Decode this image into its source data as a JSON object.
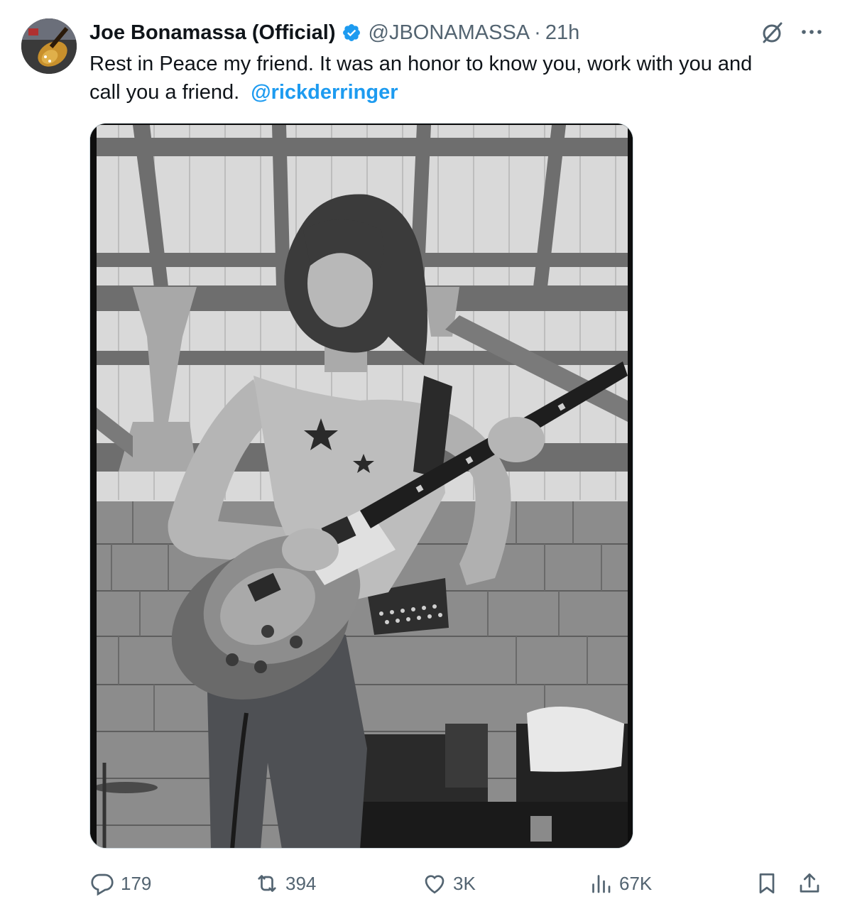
{
  "tweet": {
    "author": {
      "display_name": "Joe Bonamassa (Official)",
      "handle": "@JBONAMASSA",
      "verified": true,
      "avatar_icon": "avatar-guitar-photo"
    },
    "separator": "·",
    "time": "21h",
    "text": {
      "line1": "Rest in Peace my friend.  It was an honor to know you, work with you and",
      "line2_prefix": "call you a friend.  ",
      "mention": "@rickderringer"
    },
    "media": {
      "type": "photo",
      "style": "black-and-white"
    },
    "actions": {
      "replies": "179",
      "reposts": "394",
      "likes": "3K",
      "views": "67K"
    },
    "icons": {
      "header_right": [
        "grok-icon",
        "more-icon"
      ],
      "action_bar": [
        "reply-icon",
        "retweet-icon",
        "like-icon",
        "views-icon",
        "bookmark-icon",
        "share-icon"
      ]
    },
    "colors": {
      "text_primary": "#0f1419",
      "text_secondary": "#536471",
      "accent": "#1d9bf0",
      "border": "#cfd9de"
    }
  }
}
